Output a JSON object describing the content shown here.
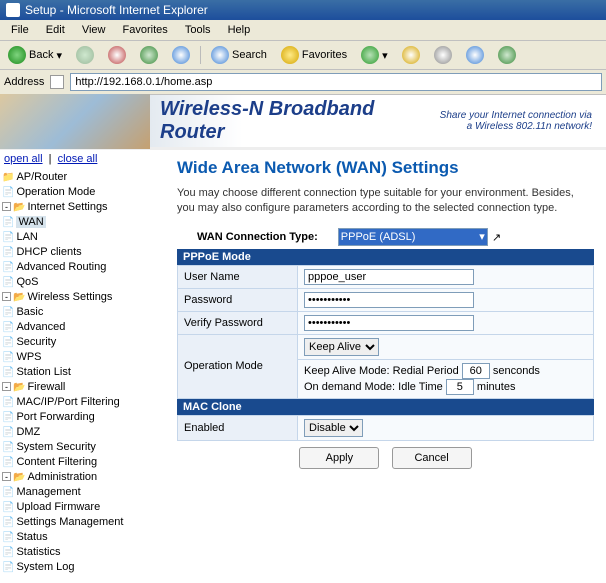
{
  "window": {
    "title": "Setup - Microsoft Internet Explorer"
  },
  "menu": [
    "File",
    "Edit",
    "View",
    "Favorites",
    "Tools",
    "Help"
  ],
  "toolbar": {
    "back": "Back",
    "search": "Search",
    "favorites": "Favorites"
  },
  "address": {
    "label": "Address",
    "value": "http://192.168.0.1/home.asp"
  },
  "banner": {
    "title": "Wireless-N Broadband Router",
    "subtitle1": "Share your Internet connection via",
    "subtitle2": "a Wireless 802.11n network!"
  },
  "top_links": {
    "open": "open all",
    "close": "close all"
  },
  "sidebar": {
    "ap": "AP/Router",
    "op": "Operation Mode",
    "inet": "Internet Settings",
    "wan": "WAN",
    "lan": "LAN",
    "dhcp": "DHCP clients",
    "adv": "Advanced Routing",
    "qos": "QoS",
    "wset": "Wireless Settings",
    "basic": "Basic",
    "advw": "Advanced",
    "sec": "Security",
    "wps": "WPS",
    "stn": "Station List",
    "fw": "Firewall",
    "mac": "MAC/IP/Port Filtering",
    "pf": "Port Forwarding",
    "dmz": "DMZ",
    "ss": "System Security",
    "cf": "Content Filtering",
    "adm": "Administration",
    "mgmt": "Management",
    "upf": "Upload Firmware",
    "setm": "Settings Management",
    "stat": "Status",
    "stats": "Statistics",
    "slog": "System Log"
  },
  "page": {
    "title": "Wide Area Network (WAN) Settings",
    "desc": "You may choose different connection type suitable for your environment. Besides, you may also configure parameters according to the selected connection type.",
    "conn_label": "WAN Connection Type:",
    "conn_value": "PPPoE (ADSL)",
    "sections": {
      "pppoe": "PPPoE Mode",
      "macclone": "MAC Clone"
    },
    "fields": {
      "user_label": "User Name",
      "user_value": "pppoe_user",
      "pass_label": "Password",
      "pass_value": "•••••••••••",
      "vpass_label": "Verify Password",
      "vpass_value": "•••••••••••",
      "opmode_label": "Operation Mode",
      "opmode_value": "Keep Alive",
      "ka_text": "Keep Alive Mode: Redial Period",
      "ka_value": "60",
      "ka_unit": "senconds",
      "od_text": "On demand Mode: Idle Time",
      "od_value": "5",
      "od_unit": "minutes",
      "enabled_label": "Enabled",
      "enabled_value": "Disable"
    },
    "buttons": {
      "apply": "Apply",
      "cancel": "Cancel"
    }
  }
}
